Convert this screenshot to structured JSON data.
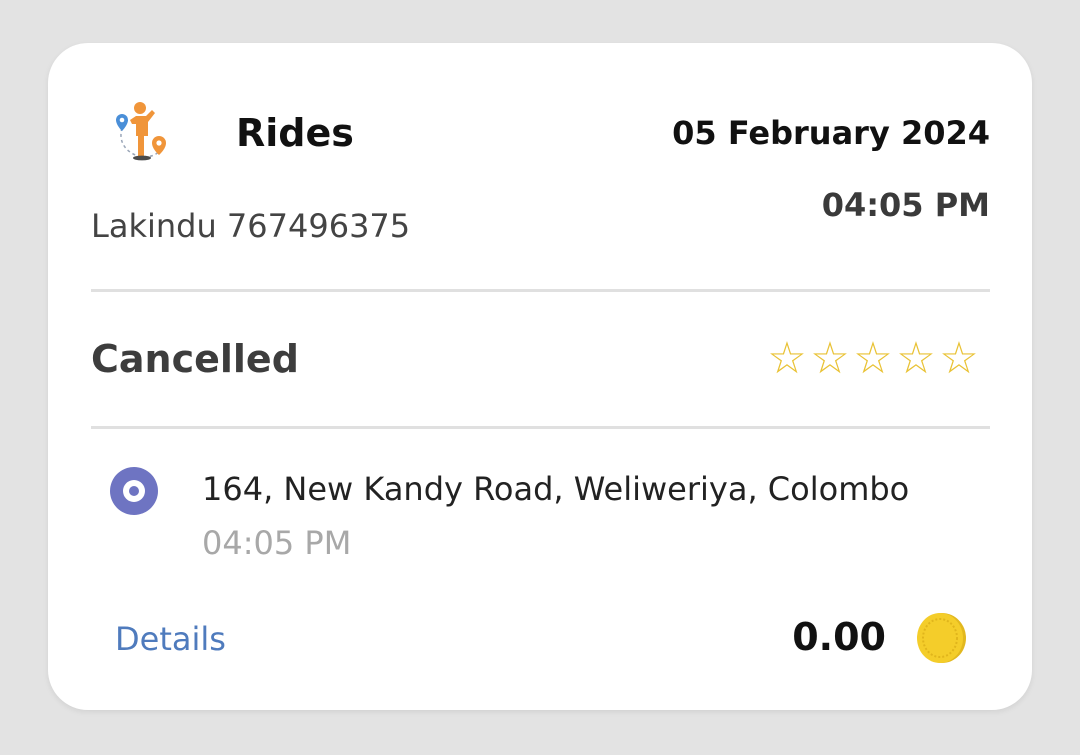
{
  "card": {
    "title": "Rides",
    "date": "05 February 2024",
    "time": "04:05 PM",
    "passenger": "Lakindu 767496375",
    "status": "Cancelled",
    "rating": {
      "value": 0,
      "max": 5,
      "star_glyph": "☆",
      "color": "#e9c235"
    },
    "location": {
      "address": "164, New Kandy Road, Weliweriya, Colombo",
      "time": "04:05 PM",
      "icon": "location-radio-icon",
      "icon_color": "#6e74c2"
    },
    "details_label": "Details",
    "fare": "0.00",
    "fare_icon": "coin-icon",
    "accent_colors": {
      "link": "#4f7bbd",
      "coin": "#f4cd2a",
      "brand": "#f0953a"
    }
  }
}
